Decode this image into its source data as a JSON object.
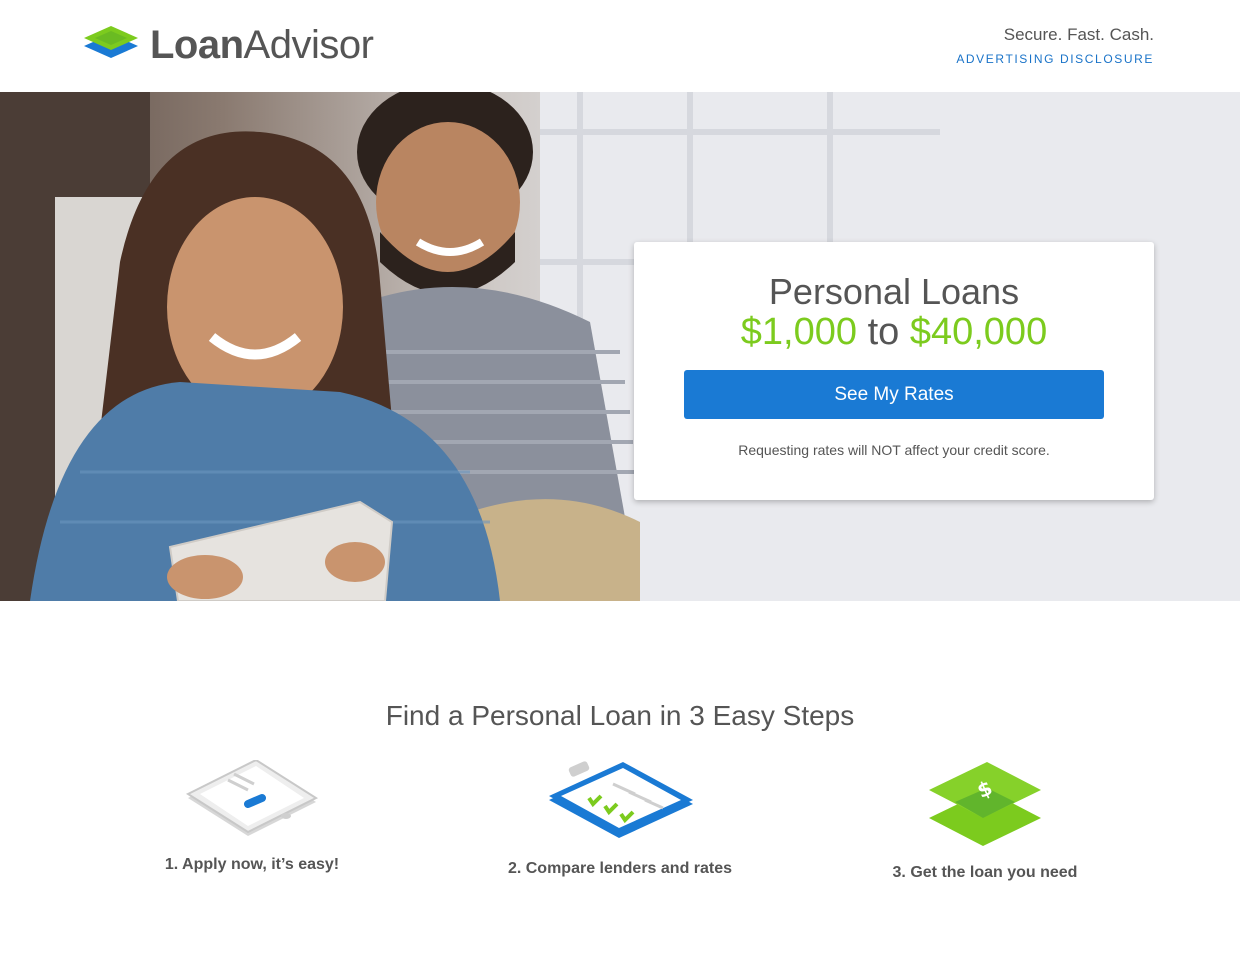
{
  "brand": {
    "name_bold": "Loan",
    "name_light": "Advisor"
  },
  "header": {
    "tagline": "Secure. Fast. Cash.",
    "disclosure": "ADVERTISING DISCLOSURE"
  },
  "hero": {
    "title": "Personal Loans",
    "amount_min": "$1,000",
    "amount_sep": "to",
    "amount_max": "$40,000",
    "cta": "See My Rates",
    "note": "Requesting rates will NOT affect your credit score."
  },
  "steps": {
    "title": "Find a Personal Loan in 3 Easy Steps",
    "items": [
      {
        "label": "1. Apply now, it’s easy!",
        "icon": "tablet-icon"
      },
      {
        "label": "2. Compare lenders and rates",
        "icon": "clipboard-icon"
      },
      {
        "label": "3. Get the loan you need",
        "icon": "money-icon"
      }
    ]
  },
  "colors": {
    "brand_blue": "#1a7ad4",
    "brand_green": "#7ccb1e",
    "text": "#555555"
  }
}
